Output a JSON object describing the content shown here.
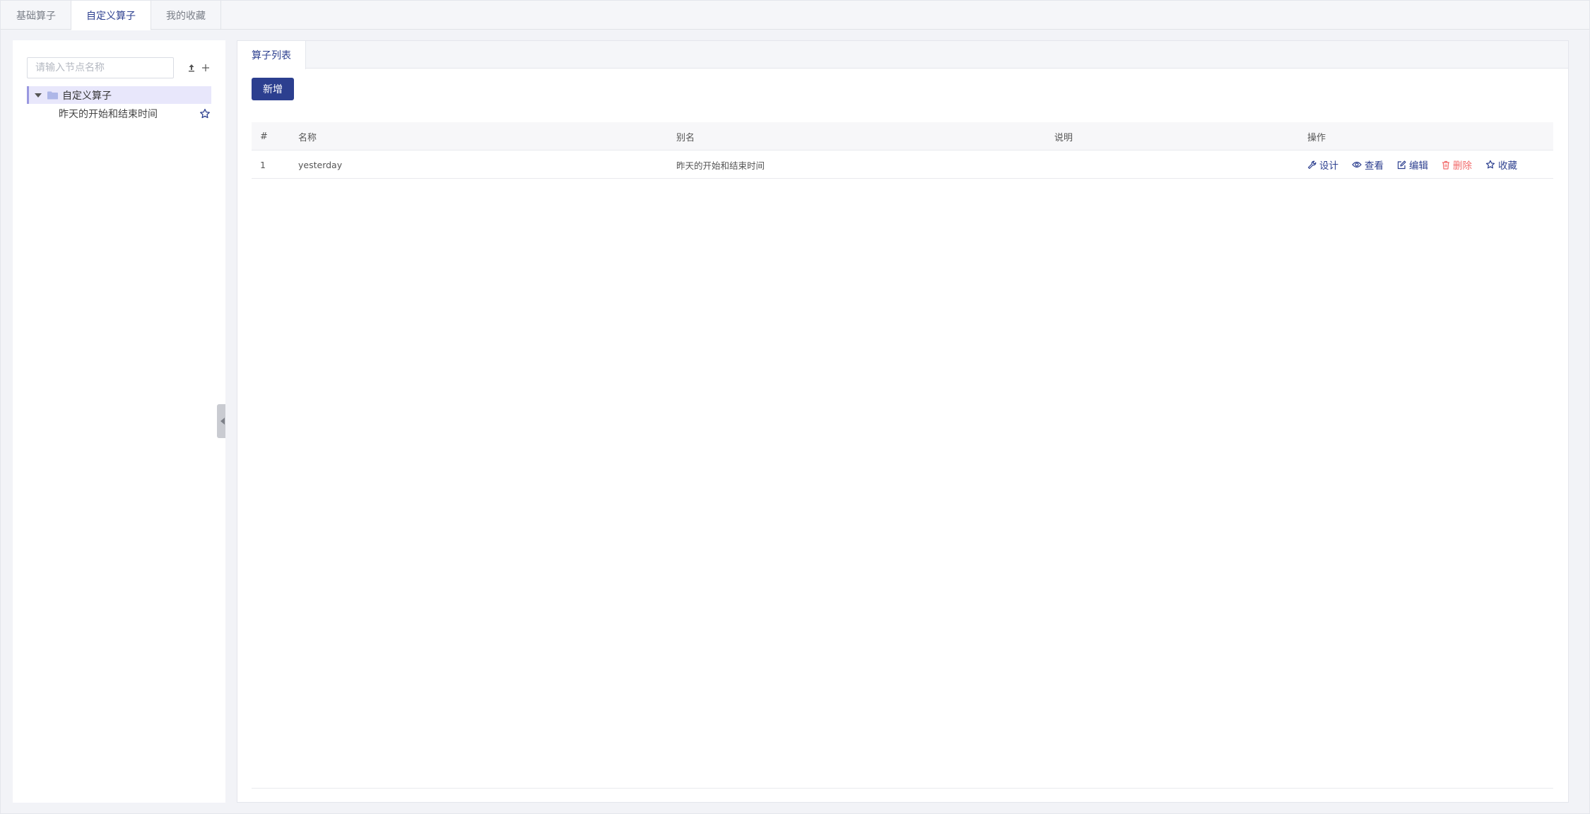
{
  "top_tabs": [
    {
      "label": "基础算子",
      "active": false
    },
    {
      "label": "自定义算子",
      "active": true
    },
    {
      "label": "我的收藏",
      "active": false
    }
  ],
  "sidebar": {
    "search_placeholder": "请输入节点名称",
    "tree": {
      "root_label": "自定义算子",
      "children": [
        {
          "label": "昨天的开始和结束时间"
        }
      ]
    }
  },
  "main": {
    "tab_label": "算子列表",
    "add_button_label": "新增",
    "table": {
      "columns": [
        "#",
        "名称",
        "别名",
        "说明",
        "操作"
      ],
      "rows": [
        {
          "index": "1",
          "name": "yesterday",
          "alias": "昨天的开始和结束时间",
          "description": ""
        }
      ],
      "actions": [
        {
          "label": "设计",
          "icon": "wrench-icon"
        },
        {
          "label": "查看",
          "icon": "eye-icon"
        },
        {
          "label": "编辑",
          "icon": "edit-icon"
        },
        {
          "label": "删除",
          "icon": "trash-icon"
        },
        {
          "label": "收藏",
          "icon": "star-icon"
        }
      ]
    }
  },
  "colors": {
    "primary": "#2c3f8f",
    "danger": "#f26b6b",
    "tree_selected_bg": "#e8e7fb"
  }
}
